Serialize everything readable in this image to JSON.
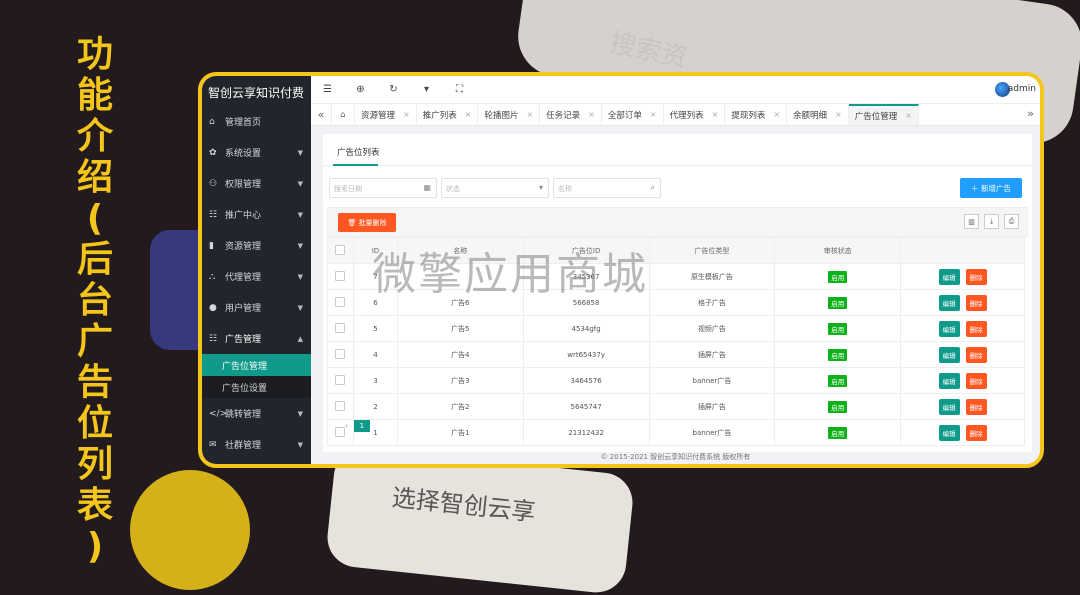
{
  "side_title": [
    "功",
    "能",
    "介",
    "绍",
    "(",
    "后",
    "台",
    "广",
    "告",
    "位",
    "列",
    "表",
    ")"
  ],
  "bg_text_top": "搜索资",
  "bg_text_bottom": "选择智创云享",
  "app": {
    "logo": "智创云享知识付费",
    "admin": "admin"
  },
  "sidebar": {
    "items": [
      {
        "label": "管理首页",
        "icon": "home-icon"
      },
      {
        "label": "系统设置",
        "icon": "gear-icon"
      },
      {
        "label": "权限管理",
        "icon": "users-icon"
      },
      {
        "label": "推广中心",
        "icon": "list-icon"
      },
      {
        "label": "资源管理",
        "icon": "book-icon"
      },
      {
        "label": "代理管理",
        "icon": "sitemap-icon"
      },
      {
        "label": "用户管理",
        "icon": "user-icon"
      },
      {
        "label": "广告管理",
        "icon": "list-icon"
      }
    ],
    "sub_items": [
      {
        "label": "广告位管理"
      },
      {
        "label": "广告位设置"
      }
    ],
    "items_after": [
      {
        "label": "跳转管理",
        "icon": "code-icon"
      },
      {
        "label": "社群管理",
        "icon": "chat-icon"
      }
    ]
  },
  "tabs": [
    "资源管理",
    "推广列表",
    "轮播图片",
    "任务记录",
    "全部订单",
    "代理列表",
    "提现列表",
    "余额明细",
    "广告位管理"
  ],
  "panel": {
    "title": "广告位列表",
    "filter_date": "搜索日期",
    "filter_status": "状态",
    "filter_name": "名称",
    "add_button": "新增广告",
    "batch_delete": "批量删除"
  },
  "table": {
    "headers": [
      "",
      "ID",
      "名称",
      "广告位ID",
      "广告位类型",
      "审核状态",
      ""
    ],
    "rows": [
      {
        "id": "7",
        "name": "",
        "ad_id": "345367",
        "type": "原生模板广告",
        "status": "启用"
      },
      {
        "id": "6",
        "name": "广告6",
        "ad_id": "566858",
        "type": "格子广告",
        "status": "启用"
      },
      {
        "id": "5",
        "name": "广告5",
        "ad_id": "4534gfg",
        "type": "视频广告",
        "status": "启用"
      },
      {
        "id": "4",
        "name": "广告4",
        "ad_id": "wrt65437y",
        "type": "插屏广告",
        "status": "启用"
      },
      {
        "id": "3",
        "name": "广告3",
        "ad_id": "3464576",
        "type": "banner广告",
        "status": "启用"
      },
      {
        "id": "2",
        "name": "广告2",
        "ad_id": "5645747",
        "type": "插屏广告",
        "status": "启用"
      },
      {
        "id": "1",
        "name": "广告1",
        "ad_id": "21312432",
        "type": "banner广告",
        "status": "启用"
      }
    ],
    "edit_label": "编辑",
    "delete_label": "删除"
  },
  "pager": {
    "current": "1"
  },
  "footer": "© 2015-2021 智创云享知识付费系统 版权所有",
  "watermark": "微擎应用商城",
  "colors": {
    "accent": "#0f9a8a",
    "danger": "#ff5722",
    "primary": "#1e9fff",
    "title": "#f4c51a"
  }
}
